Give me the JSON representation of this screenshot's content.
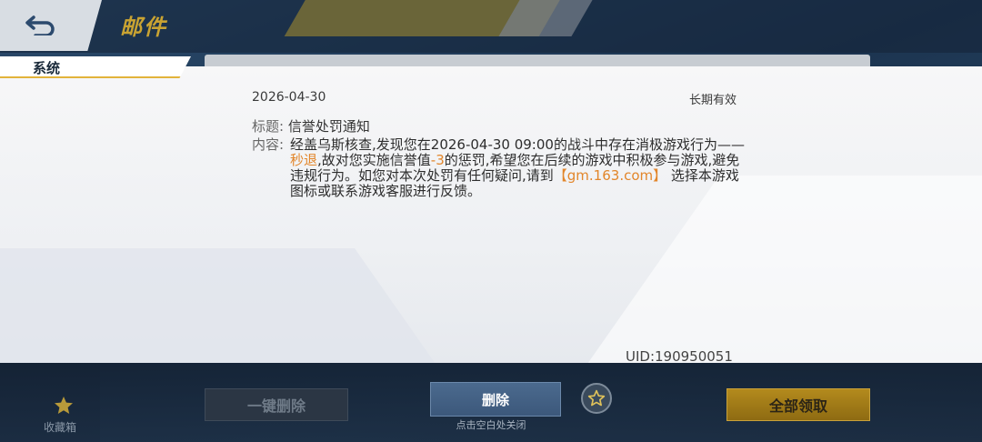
{
  "header": {
    "title": "邮件",
    "back_icon": "back-arrow-icon"
  },
  "category": {
    "label": "系统"
  },
  "mail": {
    "date": "2026-04-30",
    "validity": "长期有效",
    "subject_label": "标题:",
    "subject": "信誉处罚通知",
    "content_label": "内容:",
    "content_part1": "经盖乌斯核查,发现您在2026-04-30 09:00的战斗中存在消极游戏行为——",
    "content_highlight1": "秒退",
    "content_part2": ",故对您实施信誉值",
    "content_highlight2": "-3",
    "content_part3": "的惩罚,希望您在后续的游戏中积极参与游戏,避免违规行为。如您对本次处罚有任何疑问,请到",
    "content_link": "【gm.163.com】",
    "content_part4": " 选择本游戏图标或联系游戏客服进行反馈。",
    "uid": "UID:190950051"
  },
  "sidebar": {
    "favorites_label": "收藏箱",
    "favorites_icon": "star-icon"
  },
  "footer": {
    "one_key_delete_label": "一键删除",
    "delete_label": "删除",
    "close_hint": "点击空白处关闭",
    "favorite_icon": "star-outline-icon",
    "claim_all_label": "全部领取"
  },
  "colors": {
    "highlight": "#e2862b",
    "accent_gold": "#e2b33b",
    "delete_button": "#4b6a8e"
  }
}
